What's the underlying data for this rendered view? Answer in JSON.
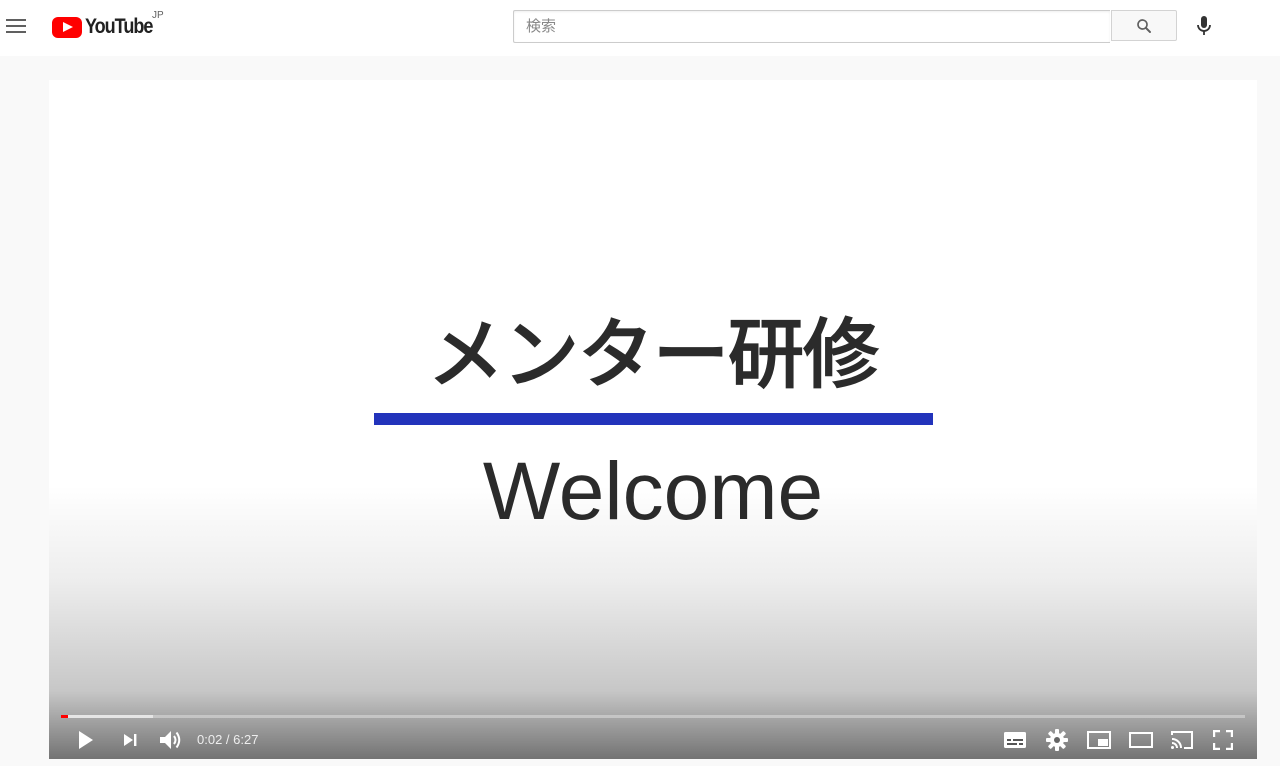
{
  "header": {
    "logo_text": "YouTube",
    "country_code": "JP",
    "search": {
      "placeholder": "検索",
      "value": ""
    },
    "icons": {
      "menu": "hamburger-menu-icon",
      "search": "search-icon",
      "mic": "microphone-icon"
    }
  },
  "video": {
    "slide_title": "メンター研修",
    "slide_subtitle": "Welcome",
    "current_time": "0:02",
    "duration": "6:27",
    "time_display": "0:02 / 6:27",
    "progress_played_fraction": 0.006,
    "progress_buffered_fraction": 0.078,
    "colors": {
      "progress_played": "#ff0000",
      "slide_rule": "#2233bb",
      "brand": "#ff0000"
    },
    "controls": {
      "left": [
        "play-icon",
        "next-icon",
        "volume-icon"
      ],
      "right": [
        "subtitles-icon",
        "settings-icon",
        "miniplayer-icon",
        "theater-mode-icon",
        "cast-icon",
        "fullscreen-icon"
      ]
    }
  }
}
